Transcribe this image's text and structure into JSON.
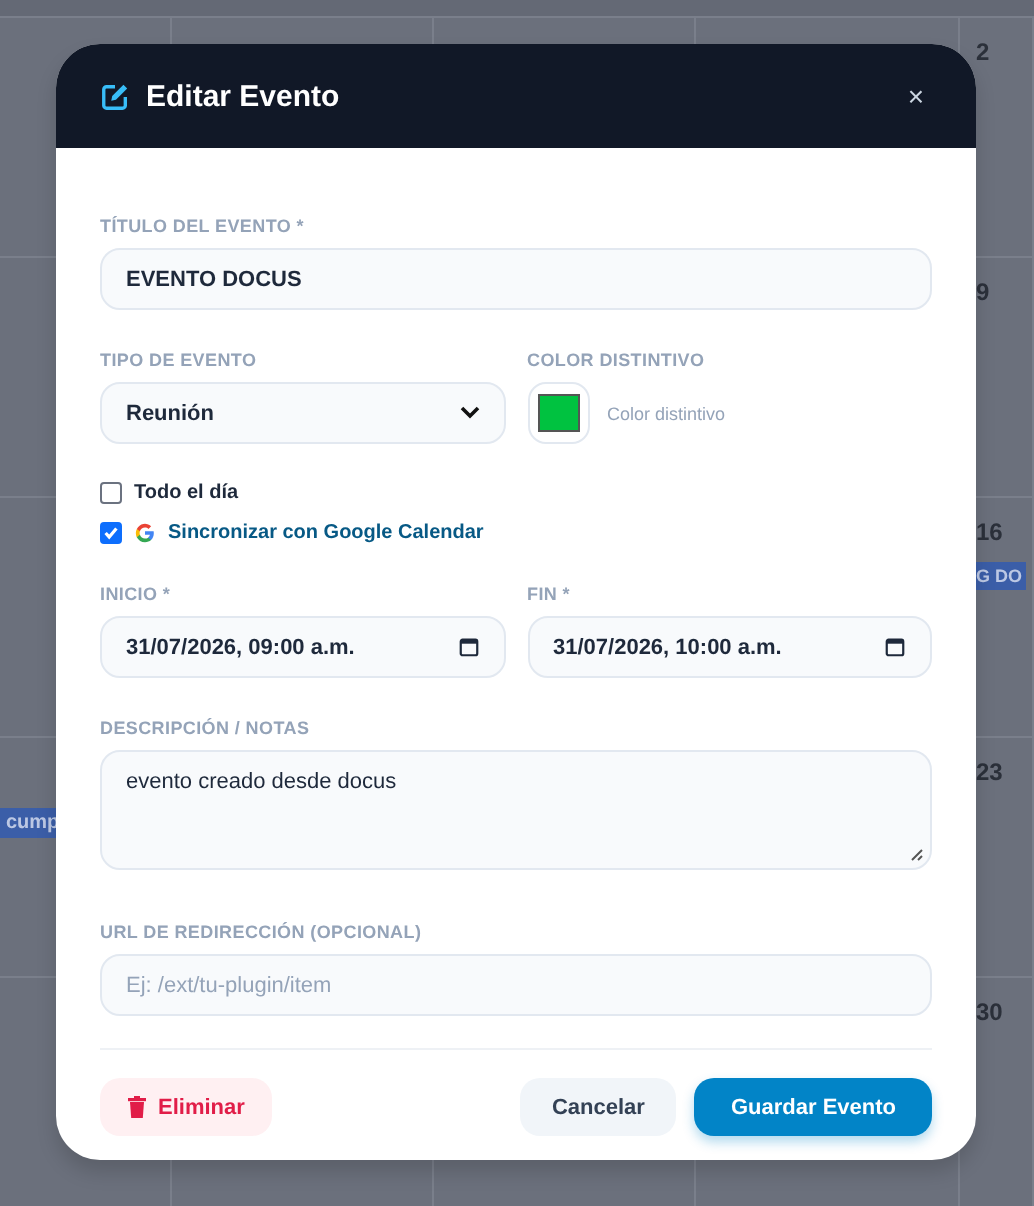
{
  "calendar": {
    "weeks": [
      {
        "last_day": "2"
      },
      {
        "last_day": "9"
      },
      {
        "last_day": "16",
        "last_day_event": "G DO"
      },
      {
        "last_day": "23",
        "first_day_event": "cump"
      },
      {
        "last_day": "30"
      }
    ]
  },
  "dialog": {
    "title": "Editar Evento",
    "close": "×",
    "title_field": {
      "label": "TÍTULO DEL EVENTO *",
      "value": "EVENTO DOCUS"
    },
    "type_field": {
      "label": "TIPO DE EVENTO",
      "value": "Reunión"
    },
    "color_field": {
      "label": "COLOR DISTINTIVO",
      "color": "#00c240",
      "hint": "Color distintivo"
    },
    "checkboxes": [
      {
        "label": "Todo el día",
        "checked": false,
        "kind": "plain"
      },
      {
        "label": "Sincronizar con Google Calendar",
        "checked": true,
        "kind": "google"
      }
    ],
    "start_field": {
      "label": "INICIO *",
      "value": "31/07/2026, 09:00 a.m."
    },
    "end_field": {
      "label": "FIN *",
      "value": "31/07/2026, 10:00 a.m."
    },
    "description_field": {
      "label": "DESCRIPCIÓN / NOTAS",
      "value": "evento creado desde docus"
    },
    "url_field": {
      "label": "URL DE REDIRECCIÓN (OPCIONAL)",
      "placeholder": "Ej: /ext/tu-plugin/item"
    },
    "buttons": [
      {
        "label": "Eliminar",
        "kind": "danger"
      },
      {
        "label": "Cancelar",
        "kind": "secondary"
      },
      {
        "label": "Guardar Evento",
        "kind": "primary"
      }
    ]
  }
}
